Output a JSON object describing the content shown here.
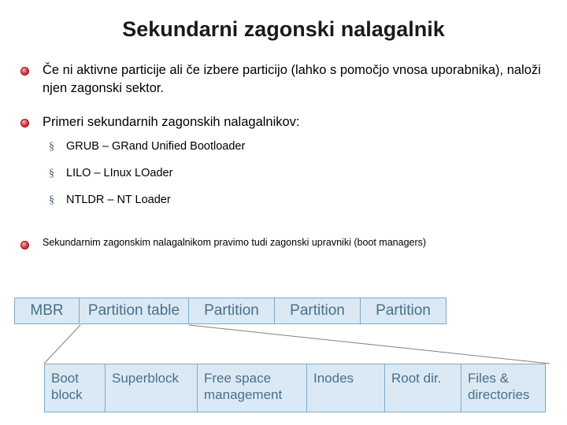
{
  "slide": {
    "title": "Sekundarni zagonski nalagalnik",
    "bullets": [
      {
        "text": "Če ni aktivne particije ali če izbere particijo (lahko s pomočjo vnosa uporabnika), naloži njen zagonski sektor.",
        "marker": "red-dot-bullet"
      },
      {
        "text": "Primeri sekundarnih zagonskih nalagalnikov:",
        "marker": "red-dot-bullet"
      },
      {
        "text": "Sekundarnim zagonskim nalagalnikom pravimo tudi zagonski upravniki (boot managers)",
        "marker": "red-dot-bullet"
      }
    ],
    "sub_bullets": [
      {
        "marker": "§",
        "text": "GRUB – GRand Unified Bootloader"
      },
      {
        "marker": "§",
        "text": "LILO – LInux LOader"
      },
      {
        "marker": "§",
        "text": "NTLDR – NT Loader"
      }
    ],
    "diagram": {
      "disk_blocks": [
        "MBR",
        "Partition table",
        "Partition",
        "Partition",
        "Partition"
      ],
      "filesystem_blocks": [
        "Boot block",
        "Superblock",
        "Free space management",
        "Inodes",
        "Root dir.",
        "Files & directories"
      ]
    },
    "colors": {
      "block_fill": "#dbe9f4",
      "block_border": "#7fa8c9",
      "block_text": "#4a6f8a",
      "bullet_dot": "#b3121f"
    }
  }
}
